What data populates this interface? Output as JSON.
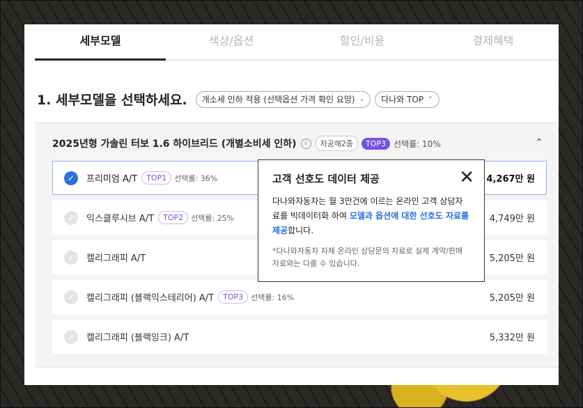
{
  "tabs": [
    {
      "label": "세부모델"
    },
    {
      "label": "색상/옵션"
    },
    {
      "label": "할인/비용"
    },
    {
      "label": "결제혜택"
    }
  ],
  "heading": "1. 세부모델을 선택하세요.",
  "filters": {
    "tax_chip": "개소세 인하 적용 (선택옵션 가격 확인 요망)",
    "top_chip": "다나와 TOP"
  },
  "group": {
    "title": "2025년형 가솔린 터보 1.6 하이브리드 (개별소비세 인하)",
    "info": "i",
    "tag_gray": "저공해2종",
    "tag_top": "TOP3",
    "rate": "선택률: 10%"
  },
  "rows": [
    {
      "name": "프리미엄 A/T",
      "tag": "TOP1",
      "rate": "선택률: 36%",
      "price": "4,267만 원"
    },
    {
      "name": "익스클루시브 A/T",
      "tag": "TOP2",
      "rate": "선택률: 25%",
      "price": "4,749만 원"
    },
    {
      "name": "캘리그래피 A/T",
      "tag": "",
      "rate": "",
      "price": "5,205만 원"
    },
    {
      "name": "캘리그래피 (블랙익스테리어) A/T",
      "tag": "TOP3",
      "rate": "선택률: 16%",
      "price": "5,205만 원"
    },
    {
      "name": "캘리그래피 (블랙잉크) A/T",
      "tag": "",
      "rate": "",
      "price": "5,332만 원"
    }
  ],
  "popover": {
    "title": "고객 선호도 데이터 제공",
    "body_1": "다나와자동차는 월 3만건에 이르는 온라인 고객 상담자료를 빅데이터화 하여 ",
    "body_hl": "모델과 옵션에 대한 선호도 자료를 제공",
    "body_2": "합니다.",
    "note": "*다나와자동차 자체 온라인 상담문의 자료로 실제 계약/판매 자료와는 다를 수 있습니다."
  }
}
